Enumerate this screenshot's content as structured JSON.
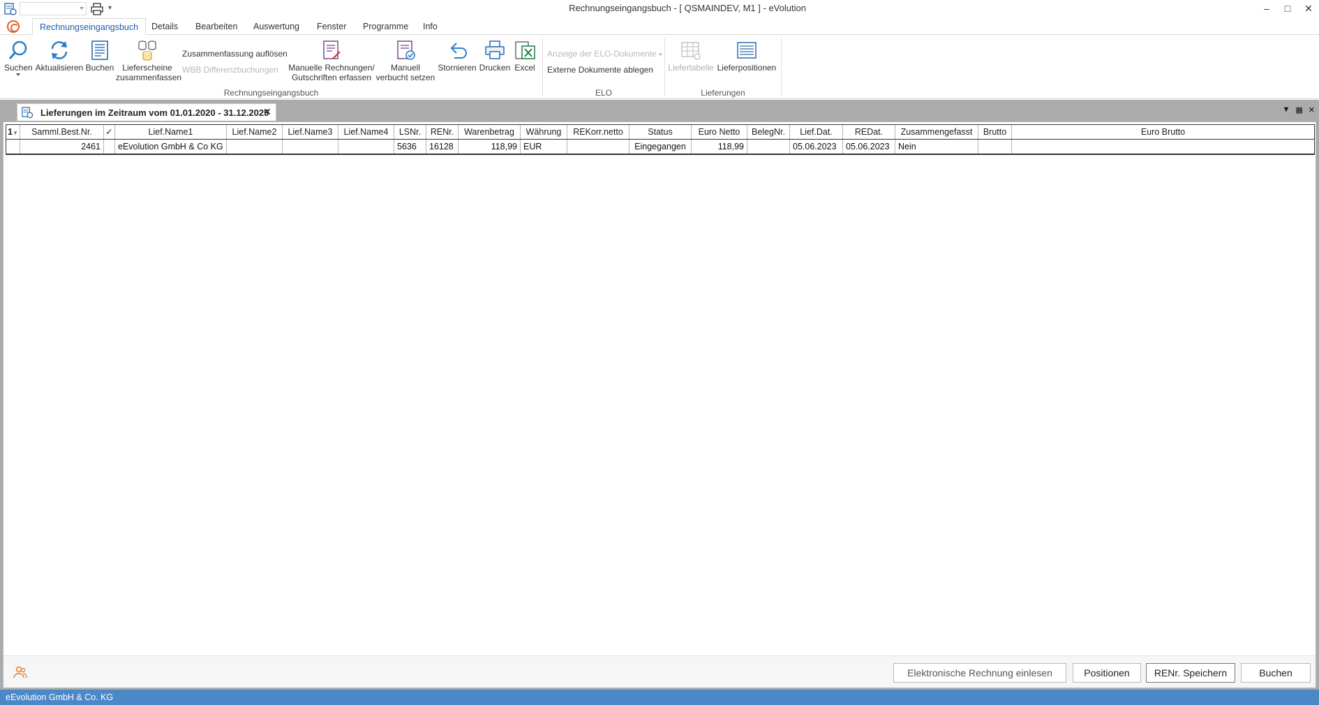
{
  "window": {
    "title": "Rechnungseingangsbuch - [ QSMAINDEV, M1 ]  -  eVolution",
    "minimize": "–",
    "maximize": "□",
    "close": "✕"
  },
  "quick_access": {
    "more": "▾"
  },
  "ribbon_tabs": [
    {
      "label": "Rechnungseingangsbuch",
      "active": true
    },
    {
      "label": "Details"
    },
    {
      "label": "Bearbeiten"
    },
    {
      "label": "Auswertung"
    },
    {
      "label": "Fenster"
    },
    {
      "label": "Programme"
    },
    {
      "label": "Info"
    }
  ],
  "ribbon": {
    "groups": {
      "rechnungseingangsbuch": "Rechnungseingangsbuch",
      "elo": "ELO",
      "lieferungen": "Lieferungen"
    },
    "buttons": {
      "suchen": "Suchen",
      "aktualisieren": "Aktualisieren",
      "buchen": "Buchen",
      "lieferscheine_1": "Lieferscheine",
      "lieferscheine_2": "zusammenfassen",
      "zusammenfassung_aufloesen": "Zusammenfassung  auflösen",
      "wbb_differenzbuchungen": "WBB Differenzbuchungen",
      "manuelle_rechnungen_1": "Manuelle Rechnungen/",
      "manuelle_rechnungen_2": "Gutschriften erfassen",
      "manuell_verbucht_1": "Manuell",
      "manuell_verbucht_2": "verbucht setzen",
      "stornieren": "Stornieren",
      "drucken": "Drucken",
      "excel": "Excel",
      "anzeige_elo": "Anzeige der ELO-Dokumente",
      "externe_dokumente": "Externe Dokumente ablegen",
      "liefertabelle": "Liefertabelle",
      "lieferpositionen": "Lieferpositionen"
    }
  },
  "document_tab": {
    "title": "Lieferungen im Zeitraum vom 01.01.2020 - 31.12.2025",
    "close": "✕"
  },
  "doc_controls": {
    "dropdown": "▼",
    "layout": "▦",
    "close": "✕"
  },
  "grid": {
    "sort_indicator": "1",
    "columns": [
      "Samml.Best.Nr.",
      "✓",
      "Lief.Name1",
      "Lief.Name2",
      "Lief.Name3",
      "Lief.Name4",
      "LSNr.",
      "RENr.",
      "Warenbetrag",
      "Währung",
      "REKorr.netto",
      "Status",
      "Euro Netto",
      "BelegNr.",
      "Lief.Dat.",
      "REDat.",
      "Zusammengefasst",
      "Brutto",
      "Euro Brutto"
    ],
    "rows": [
      {
        "samml_best_nr": "2461",
        "check": "",
        "lief_name1": "eEvolution GmbH & Co KG",
        "lief_name2": "",
        "lief_name3": "",
        "lief_name4": "",
        "lsnr": "5636",
        "renr": "16128",
        "warenbetrag": "118,99",
        "waehrung": "EUR",
        "rekorr_netto": "",
        "status": "Eingegangen",
        "euro_netto": "118,99",
        "belegnr": "",
        "lief_dat": "05.06.2023",
        "redat": "05.06.2023",
        "zusammengefasst": "Nein",
        "brutto": "",
        "euro_brutto": ""
      }
    ]
  },
  "bottom_buttons": {
    "elektronische_rechnung": "Elektronische Rechnung einlesen",
    "positionen": "Positionen",
    "renr_speichern": "RENr. Speichern",
    "buchen": "Buchen"
  },
  "statusbar": {
    "company": "eEvolution GmbH & Co. KG"
  },
  "colors": {
    "accent": "#1e5fa8",
    "statusbar": "#4a88c7",
    "orb": "#e0612a"
  }
}
